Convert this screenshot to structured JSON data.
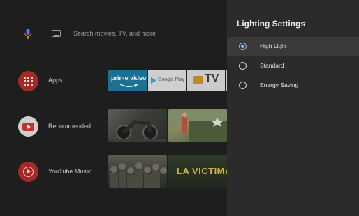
{
  "search": {
    "placeholder": "Search movies, TV, and more"
  },
  "rows": [
    {
      "label": "Apps"
    },
    {
      "label": "Recommended"
    },
    {
      "label": "YouTube Music"
    }
  ],
  "apps": [
    {
      "name": "prime video"
    },
    {
      "name": "Google Play"
    },
    {
      "name": "TV"
    }
  ],
  "thumbnails": {
    "music_title": "LA VICTIMA"
  },
  "panel": {
    "title": "Lighting Settings",
    "options": [
      {
        "label": "High Light",
        "selected": true
      },
      {
        "label": "Standard",
        "selected": false
      },
      {
        "label": "Energy Saving",
        "selected": false
      }
    ]
  },
  "colors": {
    "accent": "#8fb4f5",
    "app_red": "#a42a26",
    "panel_bg": "#2b2b2b"
  }
}
